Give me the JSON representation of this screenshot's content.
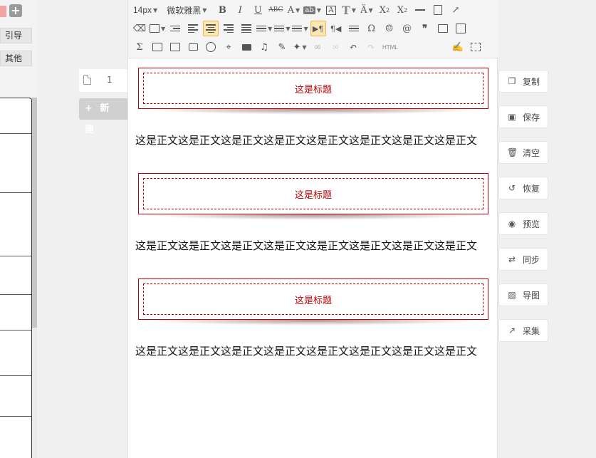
{
  "left": {
    "categories": [
      "引导",
      "其他"
    ]
  },
  "pages": {
    "items": [
      {
        "number": "1"
      }
    ],
    "new_label": "+ 新 建"
  },
  "toolbar": {
    "font_size": "14px",
    "font_family": "微软雅黑",
    "html_label": "HTML"
  },
  "document": {
    "blocks": [
      {
        "title": "这是标题",
        "body": "这是正文这是正文这是正文这是正文这是正文这是正文这是正文这是正文"
      },
      {
        "title": "这是标题",
        "body": "这是正文这是正文这是正文这是正文这是正文这是正文这是正文这是正文"
      },
      {
        "title": "这是标题",
        "body": "这是正文这是正文这是正文这是正文这是正文这是正文这是正文这是正文"
      }
    ]
  },
  "actions": [
    {
      "label": "复制",
      "icon": "copy-icon"
    },
    {
      "label": "保存",
      "icon": "save-icon"
    },
    {
      "label": "清空",
      "icon": "trash-icon"
    },
    {
      "label": "恢复",
      "icon": "restore-icon"
    },
    {
      "label": "预览",
      "icon": "eye-icon"
    },
    {
      "label": "同步",
      "icon": "sync-icon"
    },
    {
      "label": "导图",
      "icon": "image-export-icon"
    },
    {
      "label": "采集",
      "icon": "collect-icon"
    }
  ],
  "colors": {
    "accent_red": "#c00000",
    "active_tool": "#fbe6b4"
  }
}
